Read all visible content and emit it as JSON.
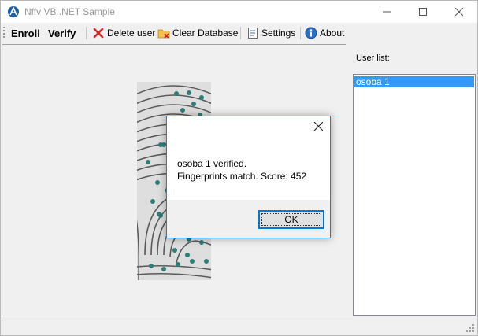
{
  "window": {
    "title": "Nffv VB .NET Sample"
  },
  "toolbar": {
    "enroll_label": "Enroll",
    "verify_label": "Verify",
    "delete_user_label": "Delete user",
    "clear_database_label": "Clear Database",
    "settings_label": "Settings",
    "about_label": "About"
  },
  "user_panel": {
    "label": "User list:",
    "items": [
      {
        "label": "osoba 1",
        "selected": true
      }
    ]
  },
  "fingerprint": {
    "minutiae_color": "#2e7d78",
    "description_icon": "fingerprint-image"
  },
  "dialog": {
    "line1": "osoba 1 verified.",
    "line2": "Fingerprints match. Score: 452",
    "ok_label": "OK"
  },
  "colors": {
    "selection": "#3399ff",
    "dialog_border": "#1883d7",
    "delete_icon": "#d42a2a"
  }
}
